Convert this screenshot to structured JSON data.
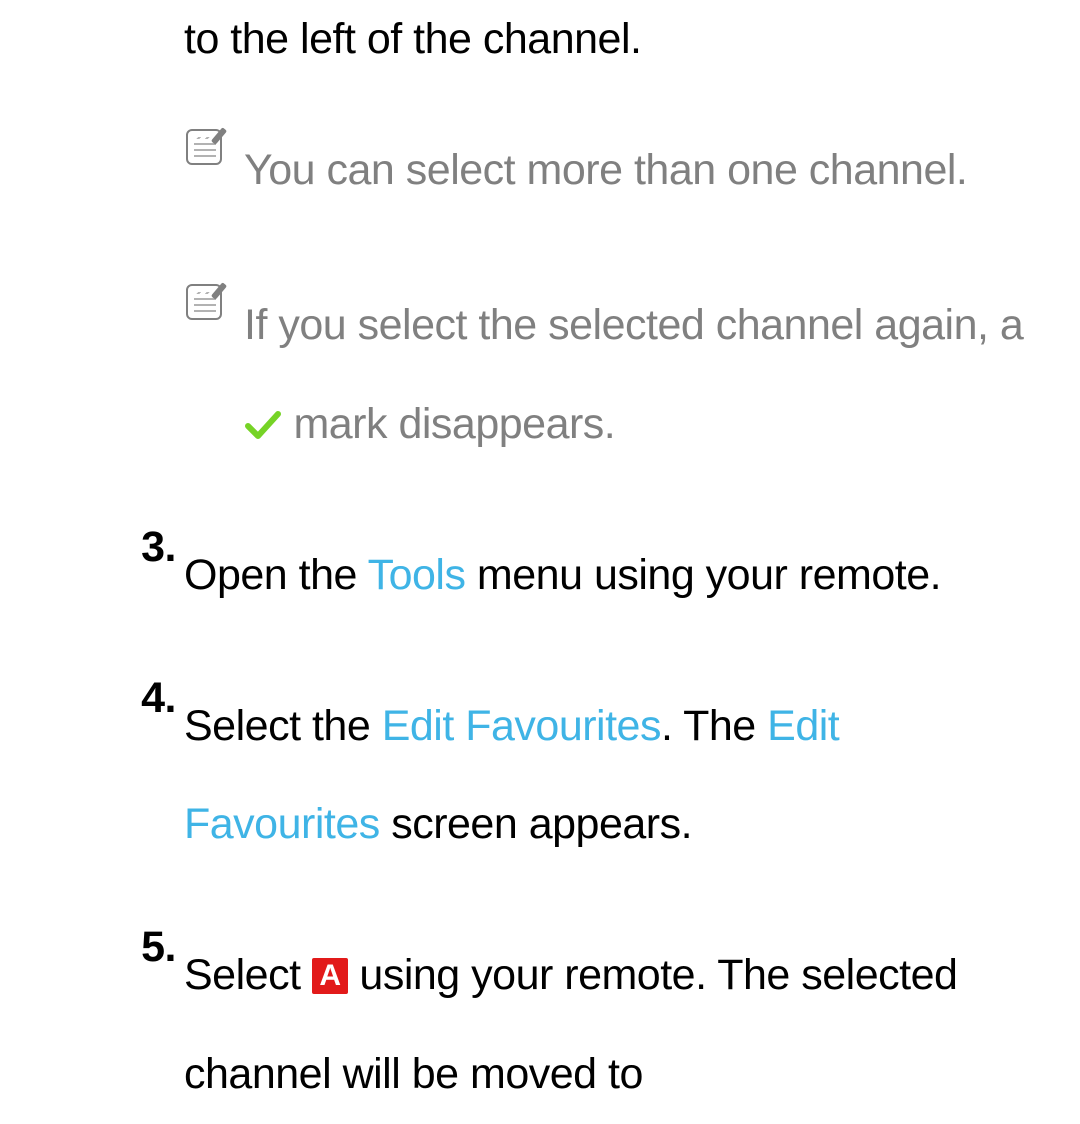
{
  "leading_fragment": "to the left of the channel.",
  "notes": [
    {
      "text": "You can select more than one channel."
    },
    {
      "text_before": "If you select the selected channel again, a ",
      "text_after": " mark disappears."
    }
  ],
  "steps": {
    "s3": {
      "num": "3.",
      "before": "Open the ",
      "hl1": "Tools",
      "after": " menu using your remote."
    },
    "s4": {
      "num": "4.",
      "t1": "Select the ",
      "hl1": "Edit Favourites",
      "t2": ". The ",
      "hl2": "Edit Favourites",
      "t3": " screen appears."
    },
    "s5": {
      "num": "5.",
      "t1": "Select ",
      "badge": "A",
      "t2": " using your remote. The selected channel will be moved to"
    }
  },
  "icons": {
    "note_icon_name": "note-icon",
    "check_name": "check-icon",
    "badge_name": "remote-a-button-icon"
  },
  "colors": {
    "highlight": "#3fb4e6",
    "note_gray": "#808080",
    "check_green": "#76d326",
    "badge_red": "#e21a1a"
  }
}
